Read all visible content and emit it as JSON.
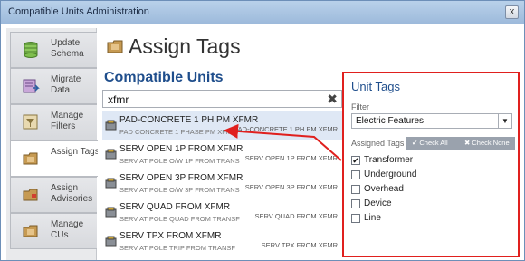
{
  "window": {
    "title": "Compatible Units Administration",
    "close_glyph": "x"
  },
  "sidebar": {
    "items": [
      {
        "label": "Update Schema",
        "icon": "database-icon",
        "active": false
      },
      {
        "label": "Migrate Data",
        "icon": "migrate-icon",
        "active": false
      },
      {
        "label": "Manage Filters",
        "icon": "filter-icon",
        "active": false
      },
      {
        "label": "Assign Tags",
        "icon": "folder-icon",
        "active": true
      },
      {
        "label": "Assign Advisories",
        "icon": "advisory-icon",
        "active": false
      },
      {
        "label": "Manage CUs",
        "icon": "folder-icon",
        "active": false
      }
    ]
  },
  "main": {
    "page_title": "Assign Tags",
    "section_title": "Compatible Units",
    "search": {
      "value": "xfmr",
      "clear_glyph": "✖"
    },
    "units": [
      {
        "name": "PAD-CONCRETE 1 PH PM XFMR",
        "desc": "PAD CONCRETE 1 PHASE PM XFMR",
        "code": "PAD-CONCRETE 1 PH PM XFMR",
        "selected": true
      },
      {
        "name": "SERV OPEN 1P FROM XFMR",
        "desc": "SERV AT POLE O/W 1P FROM TRANS",
        "code": "SERV OPEN 1P FROM XFMR",
        "selected": false
      },
      {
        "name": "SERV OPEN 3P FROM XFMR",
        "desc": "SERV AT POLE O/W 3P FROM TRANS",
        "code": "SERV OPEN 3P FROM XFMR",
        "selected": false
      },
      {
        "name": "SERV QUAD FROM XFMR",
        "desc": "SERV AT POLE QUAD FROM TRANSF",
        "code": "SERV QUAD FROM XFMR",
        "selected": false
      },
      {
        "name": "SERV TPX FROM XFMR",
        "desc": "SERV AT POLE TRIP FROM TRANSF",
        "code": "SERV TPX FROM XFMR",
        "selected": false
      }
    ]
  },
  "tags_panel": {
    "title": "Unit Tags",
    "filter_label": "Filter",
    "filter_value": "Electric Features",
    "assigned_label": "Assigned Tags",
    "check_all": "✔ Check All",
    "check_none": "✖ Check None",
    "tags": [
      {
        "label": "Transformer",
        "checked": true
      },
      {
        "label": "Underground",
        "checked": false
      },
      {
        "label": "Overhead",
        "checked": false
      },
      {
        "label": "Device",
        "checked": false
      },
      {
        "label": "Line",
        "checked": false
      }
    ]
  },
  "colors": {
    "highlight": "#e0201e",
    "accent": "#1f4e8c",
    "selected_row": "#dfe8f5"
  }
}
